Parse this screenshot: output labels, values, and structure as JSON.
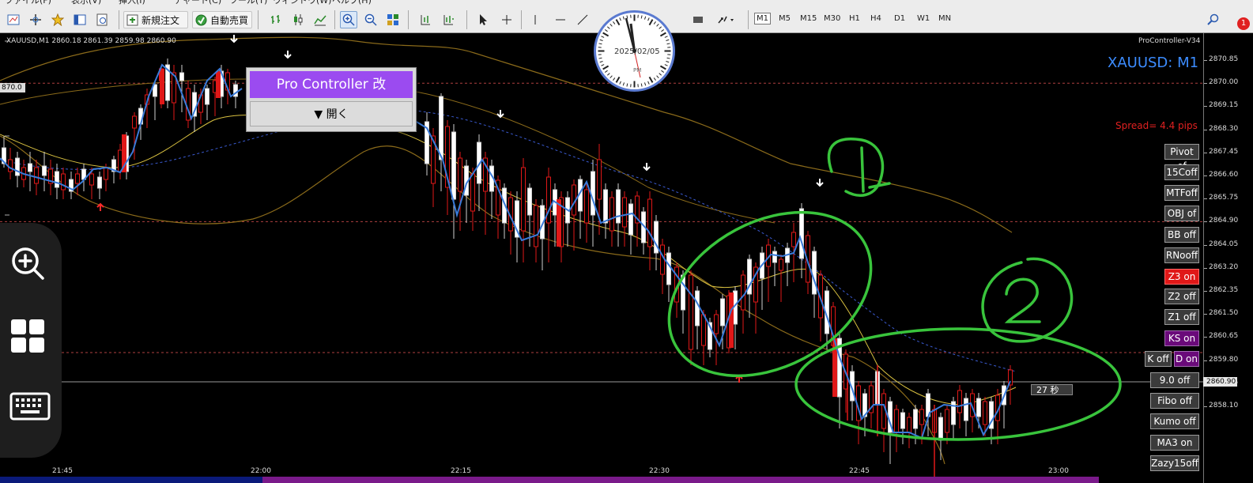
{
  "menu": {
    "items": [
      "ファイル(F)",
      "表示(V)",
      "挿入(I)",
      "チャート(C)",
      "ツール(T)",
      "ウィンドウ(W)",
      "ヘルプ(H)"
    ]
  },
  "toolbar": {
    "new_order_label": "新規注文",
    "auto_trade_label": "自動売買",
    "timeframes": [
      "M1",
      "M5",
      "M15",
      "M30",
      "H1",
      "H4",
      "D1",
      "W1",
      "MN"
    ],
    "active_timeframe": "M1",
    "notification_count": "1"
  },
  "chart": {
    "symbol_info": "XAUUSD,M1  2860.18 2861.39 2859.98 2860.90",
    "symbol_large": "XAUUSD: M1",
    "indicator_name": "ProController-V34",
    "spread_text": "Spread= 4.4 pips",
    "left_price_label": "870.0",
    "current_price_label": "2860.90",
    "countdown": "27 秒",
    "price_axis": [
      "2870.85",
      "2870.00",
      "2869.15",
      "2868.30",
      "2867.45",
      "2866.60",
      "2865.75",
      "2864.90",
      "2864.05",
      "2863.20",
      "2862.35",
      "2861.50",
      "2860.65",
      "2859.80",
      "2858.95",
      "2858.10"
    ],
    "time_axis": [
      "21:45",
      "22:00",
      "22:15",
      "22:30",
      "22:45",
      "23:00"
    ],
    "annotations": [
      "1",
      "2"
    ]
  },
  "pro_controller": {
    "title": "Pro Controller 改",
    "open_label": "▼ 開く"
  },
  "overlay_buttons": [
    {
      "label": "Pivot of",
      "style": "dark"
    },
    {
      "label": "15Coff",
      "style": "dark"
    },
    {
      "label": "MTFoff",
      "style": "dark"
    },
    {
      "label": "OBJ of",
      "style": "dark"
    },
    {
      "label": "BB off",
      "style": "dark"
    },
    {
      "label": "RNooff",
      "style": "dark"
    },
    {
      "label": "Z3 on",
      "style": "red"
    },
    {
      "label": "Z2 off",
      "style": "dark"
    },
    {
      "label": "Z1 off",
      "style": "dark"
    },
    {
      "label": "KS on",
      "style": "purple"
    },
    {
      "label": "K off",
      "style": "dark"
    },
    {
      "label": "D on",
      "style": "purple"
    },
    {
      "label": "9.0 off",
      "style": "dark"
    },
    {
      "label": "Fibo off",
      "style": "dark"
    },
    {
      "label": "Kumo off",
      "style": "dark"
    },
    {
      "label": "MA3 on",
      "style": "dark"
    },
    {
      "label": "Zazy15off",
      "style": "dark"
    }
  ],
  "clock": {
    "date_text": "2025/02/05",
    "period": "PM"
  },
  "colors": {
    "bull": "#ffffff",
    "bear": "#e01818",
    "zigzag": "#3a7ad8",
    "bollinger": "#8a6a1a",
    "ma_fast": "#d8c040",
    "ma_dashed": "#3a5ad0",
    "circle": "#39c43c",
    "level_line": "#b04040"
  }
}
